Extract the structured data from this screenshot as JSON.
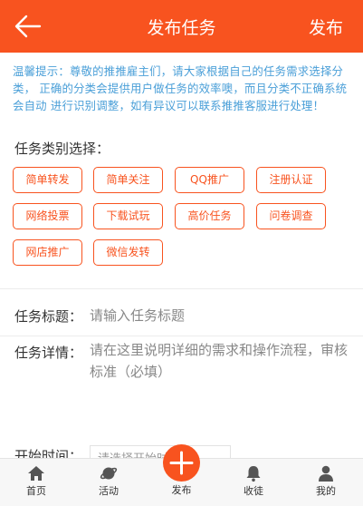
{
  "colors": {
    "accent": "#f8531f",
    "tip": "#4a9fd8"
  },
  "header": {
    "back_icon": "arrow-left-icon",
    "title": "发布任务",
    "publish_label": "发布"
  },
  "tip": {
    "text": "温馨提示：尊敬的推推雇主们，请大家根据自己的任务需求选择分类， 正确的分类会提供用户做任务的效率噢，而且分类不正确系统会自动 进行识别调整，如有异议可以联系推推客服进行处理！"
  },
  "categories": {
    "label": "任务类别选择：",
    "items": [
      "简单转发",
      "简单关注",
      "QQ推广",
      "注册认证",
      "网络投票",
      "下载试玩",
      "高价任务",
      "问卷调查",
      "网店推广",
      "微信发转"
    ]
  },
  "form": {
    "title_label": "任务标题：",
    "title_placeholder": "请输入任务标题",
    "detail_label": "任务详情：",
    "detail_placeholder": "请在这里说明详细的需求和操作流程，审核标准（必填）",
    "start_label": "开始时间：",
    "start_placeholder": "请选择开始时间"
  },
  "tabbar": {
    "items": [
      {
        "label": "首页",
        "icon": "home-icon"
      },
      {
        "label": "活动",
        "icon": "planet-icon"
      },
      {
        "label": "发布",
        "icon": "plus-icon"
      },
      {
        "label": "收徒",
        "icon": "bell-icon"
      },
      {
        "label": "我的",
        "icon": "user-icon"
      }
    ]
  }
}
